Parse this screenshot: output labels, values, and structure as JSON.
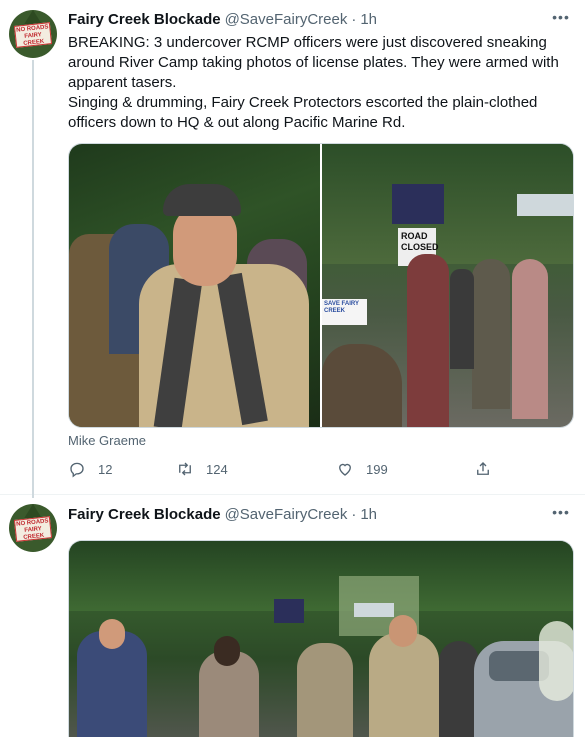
{
  "tweets": [
    {
      "avatar": {
        "sign_text": "NO ROADS FAIRY CREEK"
      },
      "display_name": "Fairy Creek Blockade",
      "handle": "@SaveFairyCreek",
      "separator": "·",
      "time": "1h",
      "text": [
        "BREAKING: 3 undercover RCMP officers were just discovered sneaking around River Camp taking photos of license plates. They were armed with apparent tasers.",
        "Singing & drumming, Fairy Creek Protectors escorted the plain-clothed officers down to HQ & out along Pacific Marine Rd."
      ],
      "photo_credit": "Mike Graeme",
      "photos": [
        {
          "sign_texts": []
        },
        {
          "sign_texts": [
            "ROAD CLOSED",
            "SAVE FAIRY CREEK"
          ]
        }
      ],
      "stats": {
        "replies": "12",
        "retweets": "124",
        "likes": "199"
      }
    },
    {
      "avatar": {
        "sign_text": "NO ROADS FAIRY CREEK"
      },
      "display_name": "Fairy Creek Blockade",
      "handle": "@SaveFairyCreek",
      "separator": "·",
      "time": "1h"
    }
  ],
  "icons": {
    "reply": "reply-icon",
    "retweet": "retweet-icon",
    "like": "heart-icon",
    "share": "share-icon",
    "more": "more-icon"
  },
  "colors": {
    "text_primary": "#0f1419",
    "text_secondary": "#536471",
    "divider": "#eff3f4",
    "thread_line": "#cfd9de"
  }
}
